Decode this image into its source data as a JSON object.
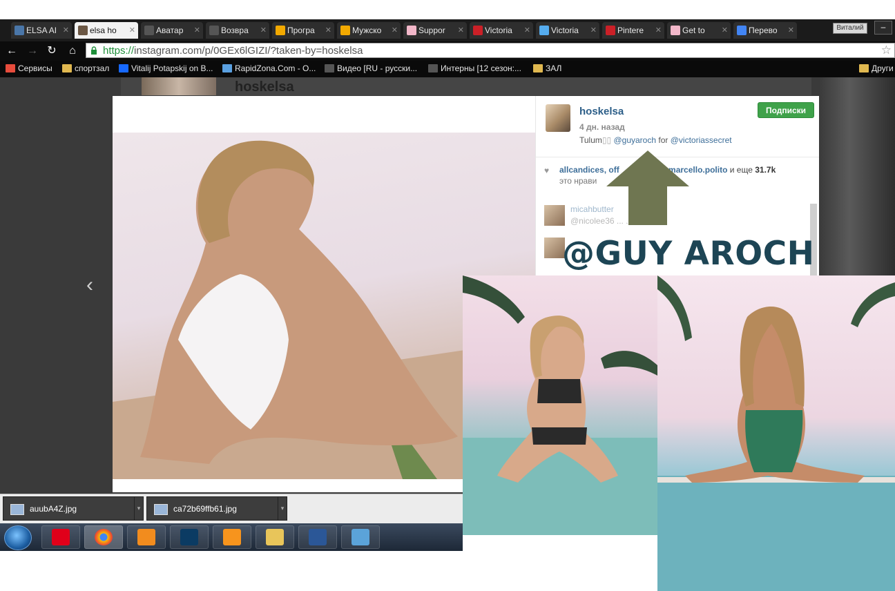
{
  "browser": {
    "tabs": [
      {
        "label": "ELSA AI",
        "favicon": "vk-icon",
        "color": "#4a76a8"
      },
      {
        "label": "elsa ho",
        "favicon": "instagram-icon",
        "color": "#6b5744",
        "active": true
      },
      {
        "label": "Аватар",
        "favicon": "ex-icon",
        "color": "#555555"
      },
      {
        "label": "Возвра",
        "favicon": "ex-icon",
        "color": "#555555"
      },
      {
        "label": "Програ",
        "favicon": "warning-icon",
        "color": "#f2a900"
      },
      {
        "label": "Мужско",
        "favicon": "warning-icon",
        "color": "#f2a900"
      },
      {
        "label": "Suppor",
        "favicon": "stripes-icon",
        "color": "#f2b7c9"
      },
      {
        "label": "Victoria",
        "favicon": "pinterest-icon",
        "color": "#cb2027"
      },
      {
        "label": "Victoria",
        "favicon": "twitter-icon",
        "color": "#55acee"
      },
      {
        "label": "Pintere",
        "favicon": "pinterest-icon",
        "color": "#cb2027"
      },
      {
        "label": "Get to",
        "favicon": "stripes-icon",
        "color": "#f2b7c9"
      },
      {
        "label": "Перево",
        "favicon": "translate-icon",
        "color": "#4285f4"
      }
    ],
    "user_badge": "Виталий",
    "minimize_glyph": "–",
    "url_scheme": "https://",
    "url_rest": "instagram.com/p/0GEx6lGIZI/?taken-by=hoskelsa",
    "star_glyph": "☆",
    "bookmarks": [
      {
        "label": "Сервисы",
        "icon": "apps-icon",
        "color": "#e74c3c"
      },
      {
        "label": "спортзал",
        "icon": "folder-icon",
        "color": "#e0b850"
      },
      {
        "label": "Vitalij Potapskij on B...",
        "icon": "behance-icon",
        "color": "#1769ff"
      },
      {
        "label": "RapidZona.Com - O...",
        "icon": "scissors-icon",
        "color": "#5aa0e0"
      },
      {
        "label": "Видео [RU - русски...",
        "icon": "ex-icon",
        "color": "#555555"
      },
      {
        "label": "Интерны [12 сезон:...",
        "icon": "ex-icon",
        "color": "#555555"
      },
      {
        "label": "ЗАЛ",
        "icon": "folder-icon",
        "color": "#e0b850"
      },
      {
        "label": "Други",
        "icon": "folder-icon",
        "color": "#e0b850"
      }
    ]
  },
  "post": {
    "behind_username": "hoskelsa",
    "username": "hoskelsa",
    "follow_label": "Подписки",
    "time_ago": "4 дн. назад",
    "caption_text": "Tulum",
    "caption_glyphs": "▯▯",
    "caption_mention1": "@guyaroch",
    "caption_for": "for",
    "caption_mention2": "@victoriassecret",
    "likes_users": "allcandices, off",
    "likes_users2": "a, marcello.polito",
    "likes_and": "и еще",
    "likes_count": "31.7k",
    "likes_line2": "это нрави",
    "comments": [
      {
        "name": "micahbutter",
        "text": "@nicolee36 ...   ...!!!!!!"
      },
      {
        "name": "",
        "text": ""
      }
    ],
    "prev_glyph": "‹"
  },
  "annotation": {
    "label": "@GUY AROCH",
    "arrow_color": "#6f7651"
  },
  "downloads": [
    {
      "name": "auubA4Z.jpg"
    },
    {
      "name": "ca72b69ffb61.jpg"
    }
  ],
  "taskbar": {
    "apps": [
      "start-button",
      "opera-icon",
      "chrome-icon",
      "media-player-icon",
      "photoshop-icon",
      "pdf-icon",
      "explorer-icon",
      "word-icon",
      "photo-viewer-icon"
    ]
  }
}
